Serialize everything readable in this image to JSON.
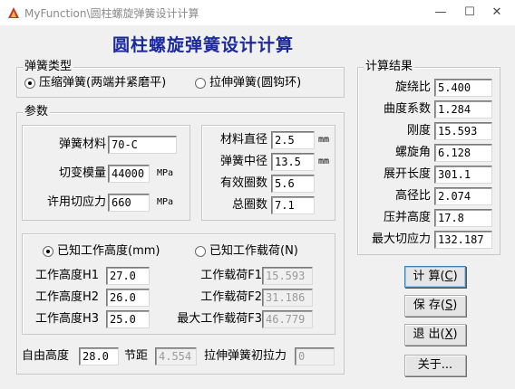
{
  "window": {
    "title": "MyFunction\\圆柱螺旋弹簧设计计算",
    "minimize_glyph": "—",
    "maximize_glyph": "☐",
    "close_glyph": "✕"
  },
  "heading": "圆柱螺旋弹簧设计计算",
  "spring_type": {
    "group_label": "弹簧类型",
    "compression_label": "压缩弹簧(两端并紧磨平)",
    "extension_label": "拉伸弹簧(圆钩环)",
    "selected": "compression"
  },
  "params": {
    "group_label": "参数",
    "material": {
      "label": "弹簧材料",
      "value": "70-C"
    },
    "shear_modulus": {
      "label": "切变模量",
      "value": "44000",
      "unit": "MPa"
    },
    "allow_shear": {
      "label": "许用切应力",
      "value": "660",
      "unit": "MPa"
    },
    "wire_diameter": {
      "label": "材料直径",
      "value": "2.5",
      "unit": "mm"
    },
    "mean_diameter": {
      "label": "弹簧中径",
      "value": "13.5",
      "unit": "mm"
    },
    "active_coils": {
      "label": "有效圈数",
      "value": "5.6"
    },
    "total_coils": {
      "label": "总圈数",
      "value": "7.1"
    }
  },
  "work": {
    "known_height_label": "已知工作高度(mm)",
    "known_load_label": "已知工作载荷(N)",
    "selected": "height",
    "h1": {
      "label": "工作高度H1",
      "value": "27.0"
    },
    "h2": {
      "label": "工作高度H2",
      "value": "26.0"
    },
    "h3": {
      "label": "工作高度H3",
      "value": "25.0"
    },
    "f1": {
      "label": "工作载荷F1",
      "value": "15.593"
    },
    "f2": {
      "label": "工作载荷F2",
      "value": "31.186"
    },
    "f3": {
      "label": "最大工作载荷F3",
      "value": "46.779"
    }
  },
  "bottom": {
    "free_height": {
      "label": "自由高度",
      "value": "28.0"
    },
    "pitch": {
      "label": "节距",
      "value": "4.554"
    },
    "initial_tension": {
      "label": "拉伸弹簧初拉力",
      "value": "0"
    }
  },
  "results": {
    "group_label": "计算结果",
    "rows": [
      {
        "label": "旋绕比",
        "value": "5.400"
      },
      {
        "label": "曲度系数",
        "value": "1.284"
      },
      {
        "label": "刚度",
        "value": "15.593"
      },
      {
        "label": "螺旋角",
        "value": "6.128"
      },
      {
        "label": "展开长度",
        "value": "301.1"
      },
      {
        "label": "高径比",
        "value": "2.074"
      },
      {
        "label": "压并高度",
        "value": "17.8"
      },
      {
        "label": "最大切应力",
        "value": "132.187"
      }
    ]
  },
  "buttons": {
    "calc": {
      "label": "计 算",
      "key": "C"
    },
    "save": {
      "label": "保 存",
      "key": "S"
    },
    "exit": {
      "label": "退 出",
      "key": "X"
    },
    "about": {
      "label": "关于..."
    }
  }
}
